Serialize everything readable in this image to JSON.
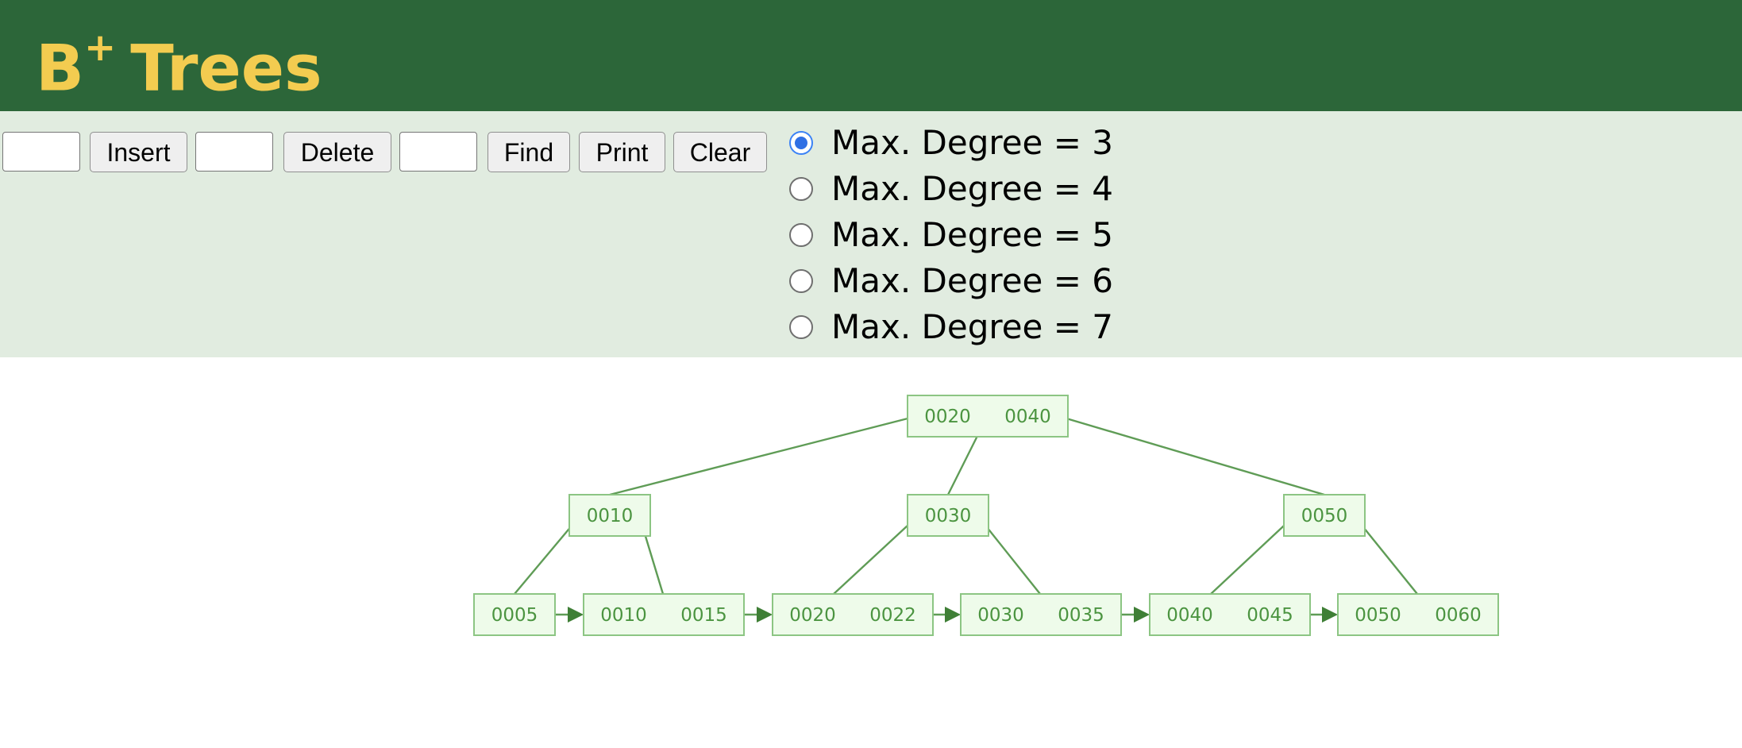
{
  "header": {
    "title": "B",
    "title_sup": "+",
    "title_rest": "Trees"
  },
  "controls": {
    "insert_value": "",
    "insert_label": "Insert",
    "delete_value": "",
    "delete_label": "Delete",
    "find_value": "",
    "find_label": "Find",
    "print_label": "Print",
    "clear_label": "Clear"
  },
  "degree_options": [
    {
      "label": "Max. Degree = 3",
      "checked": true
    },
    {
      "label": "Max. Degree = 4",
      "checked": false
    },
    {
      "label": "Max. Degree = 5",
      "checked": false
    },
    {
      "label": "Max. Degree = 6",
      "checked": false
    },
    {
      "label": "Max. Degree = 7",
      "checked": false
    }
  ],
  "tree": {
    "root": {
      "keys": [
        "0020",
        "0040"
      ]
    },
    "internal": [
      {
        "keys": [
          "0010"
        ]
      },
      {
        "keys": [
          "0030"
        ]
      },
      {
        "keys": [
          "0050"
        ]
      }
    ],
    "leaves": [
      {
        "keys": [
          "0005"
        ]
      },
      {
        "keys": [
          "0010",
          "0015"
        ]
      },
      {
        "keys": [
          "0020",
          "0022"
        ]
      },
      {
        "keys": [
          "0030",
          "0035"
        ]
      },
      {
        "keys": [
          "0040",
          "0045"
        ]
      },
      {
        "keys": [
          "0050",
          "0060"
        ]
      }
    ]
  },
  "colors": {
    "header_bg": "#2c6639",
    "title": "#f3cc50",
    "controls_bg": "#e1ece0",
    "node_fill": "#eefbea",
    "node_stroke": "#8cc583",
    "edge": "#5f9c56"
  }
}
